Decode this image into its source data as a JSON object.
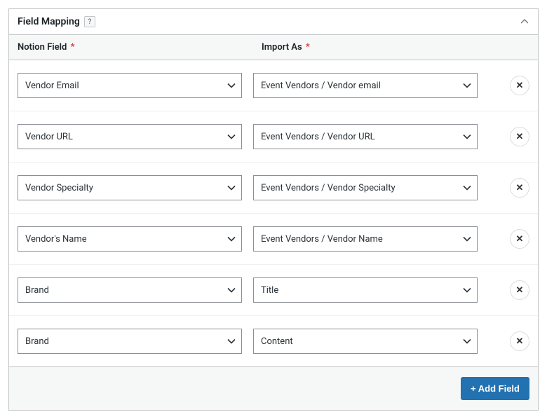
{
  "panel": {
    "title": "Field Mapping",
    "help_glyph": "?",
    "collapse_glyph": "▲"
  },
  "columns": {
    "notion": {
      "label": "Notion Field",
      "required_mark": "*"
    },
    "import": {
      "label": "Import As",
      "required_mark": "*"
    }
  },
  "rows": [
    {
      "notion": "Vendor Email",
      "import": "Event Vendors / Vendor email"
    },
    {
      "notion": "Vendor URL",
      "import": "Event Vendors / Vendor URL"
    },
    {
      "notion": "Vendor Specialty",
      "import": "Event Vendors / Vendor Specialty"
    },
    {
      "notion": "Vendor's Name",
      "import": "Event Vendors / Vendor Name"
    },
    {
      "notion": "Brand",
      "import": "Title"
    },
    {
      "notion": "Brand",
      "import": "Content"
    }
  ],
  "icons": {
    "close": "✕"
  },
  "footer": {
    "add_label": "+ Add Field"
  }
}
